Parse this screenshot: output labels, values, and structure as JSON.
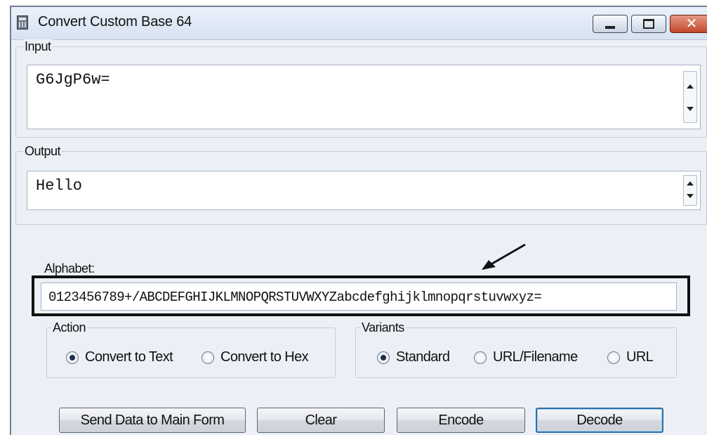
{
  "window": {
    "title": "Convert Custom Base 64",
    "close_glyph": "✕"
  },
  "input": {
    "legend": "Input",
    "value": "G6JgP6w="
  },
  "output": {
    "legend": "Output",
    "value": "Hello"
  },
  "alphabet": {
    "label": "Alphabet:",
    "value": "0123456789+/ABCDEFGHIJKLMNOPQRSTUVWXYZabcdefghijklmnopqrstuvwxyz="
  },
  "action": {
    "legend": "Action",
    "options": [
      {
        "label": "Convert to Text",
        "checked": true
      },
      {
        "label": "Convert to Hex",
        "checked": false
      }
    ]
  },
  "variants": {
    "legend": "Variants",
    "options": [
      {
        "label": "Standard",
        "checked": true
      },
      {
        "label": "URL/Filename",
        "checked": false
      },
      {
        "label": "URL",
        "checked": false
      }
    ]
  },
  "buttons": {
    "send": "Send Data to Main Form",
    "clear": "Clear",
    "encode": "Encode",
    "decode": "Decode"
  },
  "icons": {
    "app": "calculator-icon",
    "annotation": "arrow-icon"
  },
  "colors": {
    "window_bg": "#ecf0f6",
    "close_button": "#c2472b",
    "focus_border": "#2f6fa8",
    "highlight_box": "#111111"
  }
}
